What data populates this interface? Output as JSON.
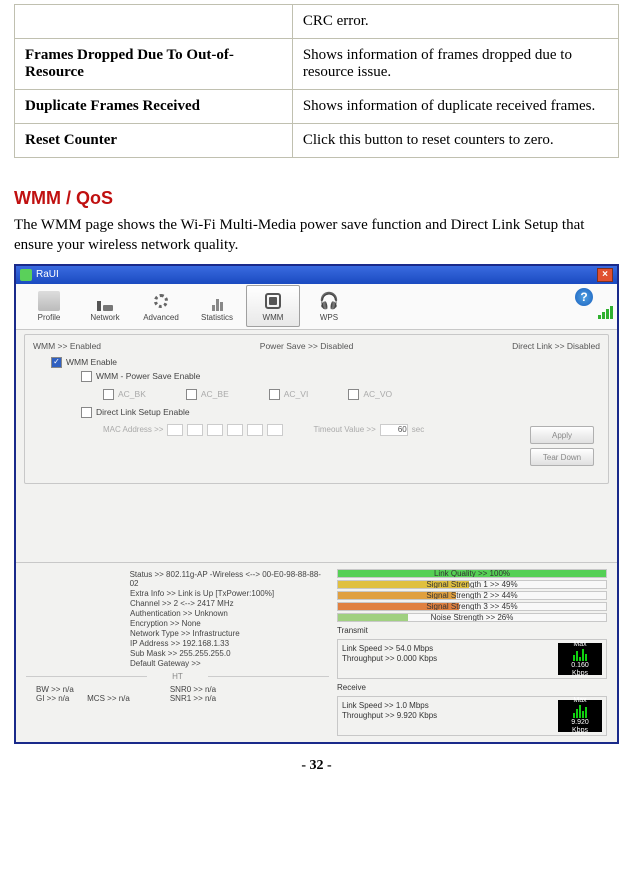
{
  "table": {
    "rows": [
      {
        "label": "",
        "desc": "CRC error."
      },
      {
        "label": "Frames Dropped Due To Out-of-Resource",
        "desc": "Shows information of frames dropped due to resource issue."
      },
      {
        "label": "Duplicate Frames Received",
        "desc": "Shows  information  of  duplicate  received frames."
      },
      {
        "label": "Reset Counter",
        "desc": "Click this button to reset counters to zero."
      }
    ]
  },
  "section_heading": "WMM / QoS",
  "intro": "The WMM page shows the Wi-Fi Multi-Media power save function and Direct Link Setup that ensure your wireless network quality.",
  "app": {
    "title": "RaUI",
    "tabs": [
      "Profile",
      "Network",
      "Advanced",
      "Statistics",
      "WMM",
      "WPS"
    ],
    "status": {
      "wmm": "WMM >> Enabled",
      "powersave": "Power Save >> Disabled",
      "directlink": "Direct Link >> Disabled"
    },
    "checks": {
      "wmm_enable": "WMM Enable",
      "ps_enable": "WMM - Power Save Enable",
      "ac_bk": "AC_BK",
      "ac_be": "AC_BE",
      "ac_vi": "AC_VI",
      "ac_vo": "AC_VO",
      "dls_enable": "Direct Link Setup Enable",
      "mac_label": "MAC Address >>",
      "timeout_label": "Timeout Value >>",
      "timeout_value": "60",
      "timeout_unit": "sec"
    },
    "buttons": {
      "apply": "Apply",
      "teardown": "Tear Down"
    },
    "info": {
      "status": "Status >> 802.11g-AP -Wireless  <--> 00-E0-98-88-88-02",
      "extra": "Extra Info >> Link is Up [TxPower:100%]",
      "channel": "Channel >> 2 <--> 2417 MHz",
      "auth": "Authentication >> Unknown",
      "encr": "Encryption >> None",
      "ntype": "Network Type >> Infrastructure",
      "ip": "IP Address >> 192.168.1.33",
      "mask": "Sub Mask >> 255.255.255.0",
      "gw": "Default Gateway >>",
      "ht_label": "HT",
      "bw": "BW >> n/a",
      "gi": "GI >> n/a",
      "mcs": "MCS >> n/a",
      "snr0": "SNR0 >> n/a",
      "snr1": "SNR1 >> n/a"
    },
    "bars": {
      "lq": {
        "label": "Link Quality >> 100%",
        "pct": 100,
        "color": "#55d055"
      },
      "s1": {
        "label": "Signal Strength 1 >> 49%",
        "pct": 49,
        "color": "#e0c040"
      },
      "s2": {
        "label": "Signal Strength 2 >> 44%",
        "pct": 44,
        "color": "#e0a040"
      },
      "s3": {
        "label": "Signal Strength 3 >> 45%",
        "pct": 45,
        "color": "#e08040"
      },
      "ns": {
        "label": "Noise Strength >> 26%",
        "pct": 26,
        "color": "#a0d080"
      }
    },
    "transmit": {
      "title": "Transmit",
      "link": "Link Speed >> 54.0 Mbps",
      "thru": "Throughput >> 0.000 Kbps",
      "max_label": "Max",
      "max_value": "0.160",
      "unit": "Kbps"
    },
    "receive": {
      "title": "Receive",
      "link": "Link Speed >> 1.0 Mbps",
      "thru": "Throughput >> 9.920 Kbps",
      "max_label": "Max",
      "max_value": "9.920",
      "unit": "Kbps"
    }
  },
  "page_number": "- 32 -"
}
